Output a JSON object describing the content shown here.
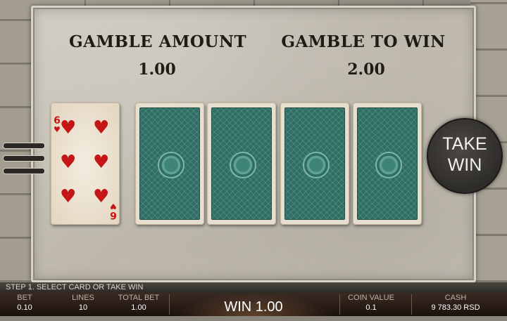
{
  "gamble": {
    "amount_label": "GAMBLE AMOUNT",
    "amount_value": "1.00",
    "to_win_label": "GAMBLE TO WIN",
    "to_win_value": "2.00"
  },
  "dealer_card": {
    "rank": "6",
    "suit": "hearts",
    "suit_symbol": "♥"
  },
  "face_down_cards": 4,
  "take_win": {
    "line1": "TAKE",
    "line2": "WIN"
  },
  "status": {
    "step": "STEP 1. SELECT CARD OR TAKE WIN"
  },
  "footer": {
    "bet_label": "BET",
    "bet_value": "0.10",
    "lines_label": "LINES",
    "lines_value": "10",
    "total_bet_label": "TOTAL BET",
    "total_bet_value": "1.00",
    "win_text": "WIN 1.00",
    "coin_value_label": "COIN VALUE",
    "coin_value_value": "0.1",
    "cash_label": "CASH",
    "cash_value": "9 783.30 RSD"
  },
  "colors": {
    "card_back": "#2f6e63",
    "heart_red": "#c41616",
    "panel_stone": "#c6c0b4"
  }
}
